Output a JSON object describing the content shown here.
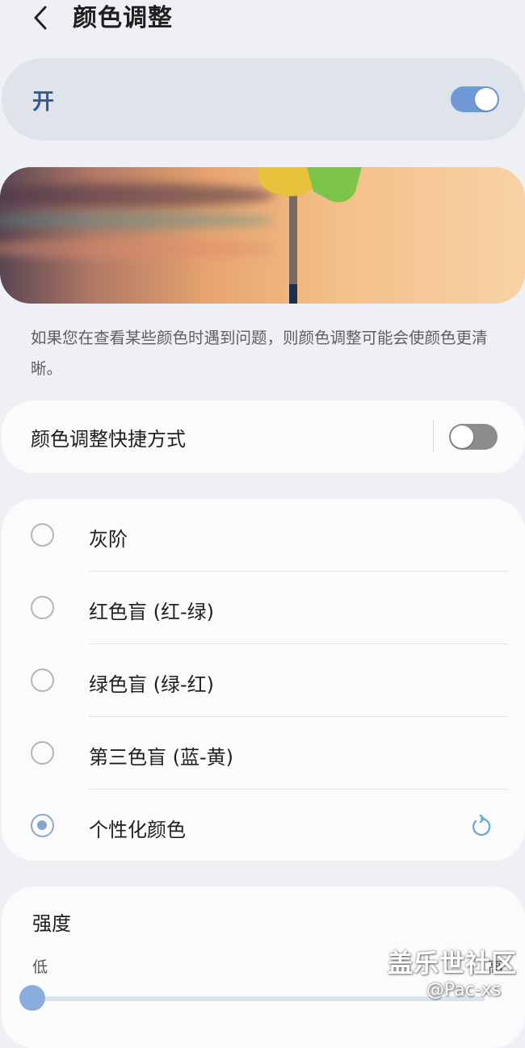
{
  "header": {
    "title": "颜色调整",
    "back_icon": "chevron-left-icon"
  },
  "master": {
    "label": "开",
    "enabled": true
  },
  "description": "如果您在查看某些颜色时遇到问题，则颜色调整可能会使颜色更清晰。",
  "shortcut": {
    "label": "颜色调整快捷方式",
    "enabled": false
  },
  "options": [
    {
      "label": "灰阶",
      "selected": false
    },
    {
      "label": "红色盲 (红-绿)",
      "selected": false
    },
    {
      "label": "绿色盲 (绿-红)",
      "selected": false
    },
    {
      "label": "第三色盲 (蓝-黄)",
      "selected": false
    },
    {
      "label": "个性化颜色",
      "selected": true
    }
  ],
  "intensity": {
    "label": "强度",
    "low_label": "低",
    "high_label": "高",
    "value": 0.0
  },
  "watermark": {
    "line1": "盖乐世社区",
    "line2": "@Pac-xs"
  },
  "colors": {
    "accent": "#6f9ad6",
    "toggle_off": "#8c8c8c",
    "background": "#eef0f5",
    "reset_icon": "#6aaed6"
  }
}
